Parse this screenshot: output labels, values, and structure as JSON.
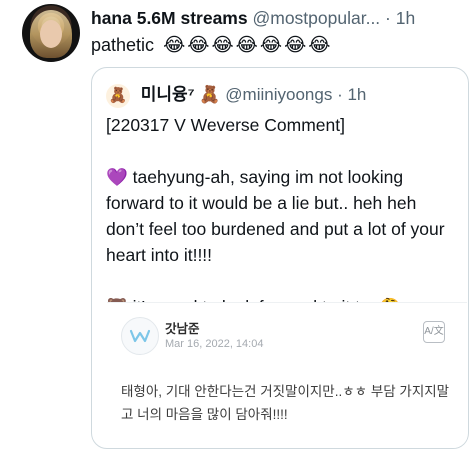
{
  "tweet": {
    "display_name": "hana 5.6M streams",
    "handle": "@mostpopular...",
    "separator": "·",
    "time": "1h",
    "text": "pathetic",
    "emojis": "😂😂😂😂😂😂😂"
  },
  "quoted_tweet": {
    "avatar_emoji": "🧸",
    "display_name": "미니융⁷ 🧸",
    "handle": "@miiniyoongs",
    "separator": "·",
    "time": "1h",
    "line1": "[220317 V Weverse Comment]",
    "paragraph2": "💜 taehyung-ah, saying im not looking forward to it would be a lie but.. heh heh don’t feel too burdened and put a lot of your heart into it!!!!",
    "paragraph3": "🐻 it’s good to look forward to it too🤔"
  },
  "weverse_card": {
    "author": "갓남준",
    "date": "Mar 16, 2022, 14:04",
    "translate_icon": "translate-icon",
    "comment": "태형아, 기대 안한다는건 거짓말이지만..ㅎㅎ 부담 가지지말고 너의 마음을 많이 담아줘!!!!"
  }
}
